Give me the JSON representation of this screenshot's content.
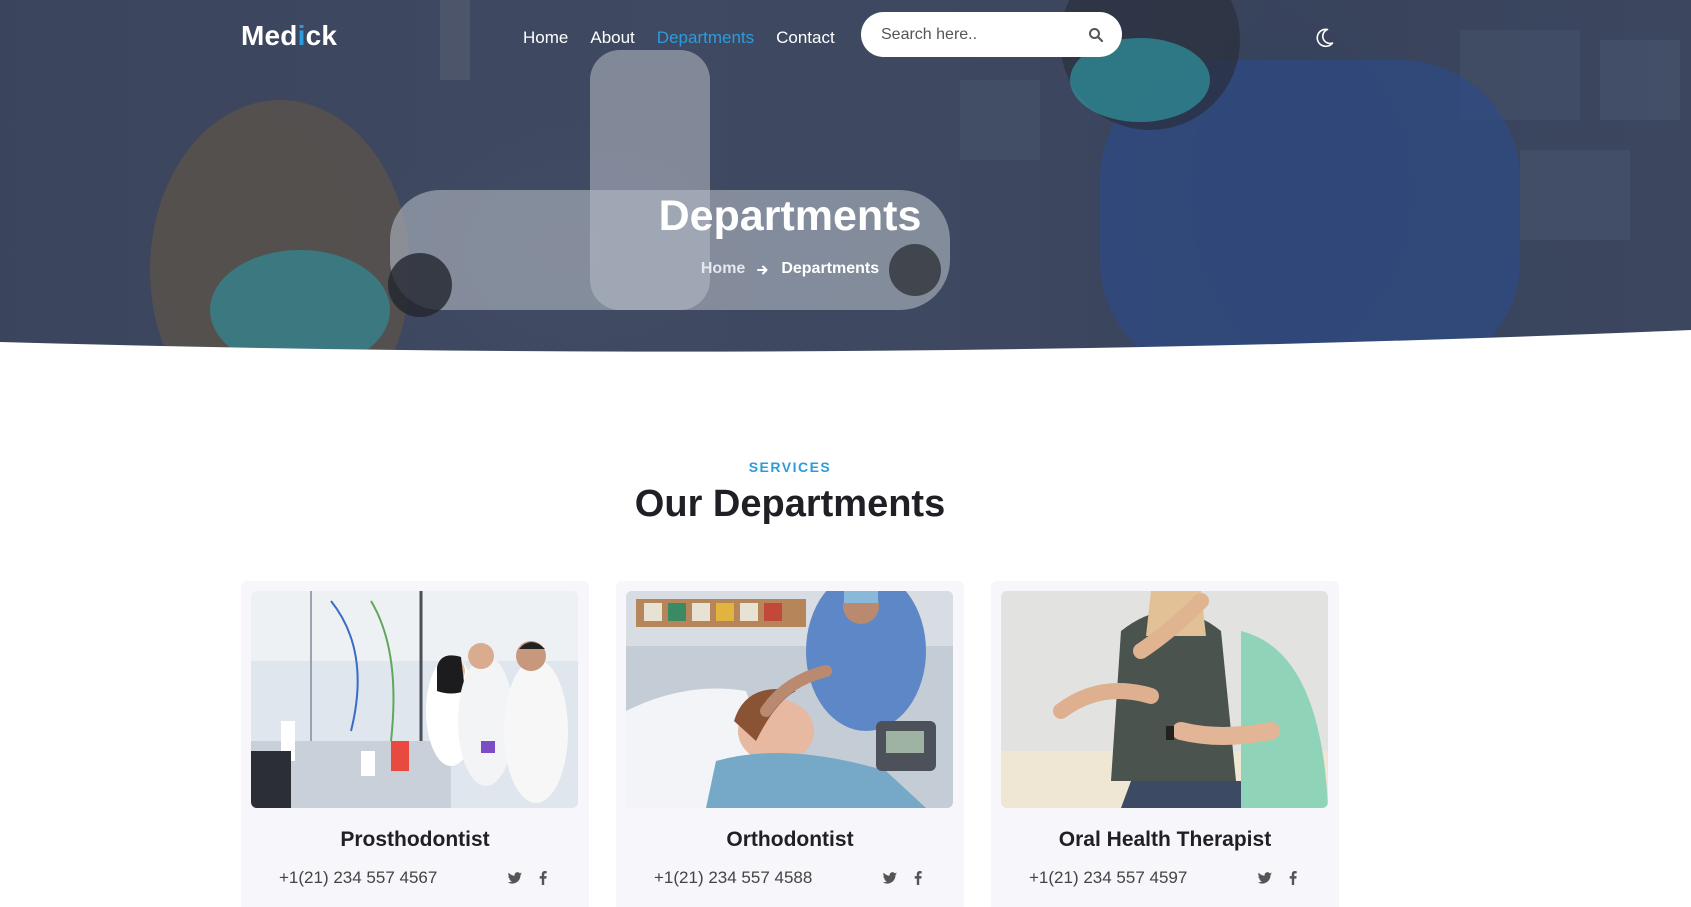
{
  "nav": {
    "logo_part1": "Med",
    "logo_accent": "i",
    "logo_part2": "ck",
    "links": [
      {
        "label": "Home"
      },
      {
        "label": "About"
      },
      {
        "label": "Departments",
        "active": true
      },
      {
        "label": "Contact"
      }
    ],
    "search_placeholder": "Search here..",
    "theme_icon": "moon-icon"
  },
  "hero": {
    "title": "Departments",
    "breadcrumb_home": "Home",
    "breadcrumb_current": "Departments",
    "breadcrumb_icon": "arrow-right-icon"
  },
  "section": {
    "subtitle": "SERVICES",
    "title": "Our Departments"
  },
  "departments": [
    {
      "name": "Prosthodontist",
      "phone": "+1(21) 234 557 4567",
      "image": "laboratory-scientists-photo"
    },
    {
      "name": "Orthodontist",
      "phone": "+1(21) 234 557 4588",
      "image": "patient-in-hospital-bed-photo"
    },
    {
      "name": "Oral Health Therapist",
      "phone": "+1(21) 234 557 4597",
      "image": "back-examination-photo"
    }
  ],
  "colors": {
    "accent": "#2d9cdb",
    "heading": "#1f1f25",
    "card_bg": "#f6f6fb",
    "hero_overlay": "#2e3750"
  }
}
